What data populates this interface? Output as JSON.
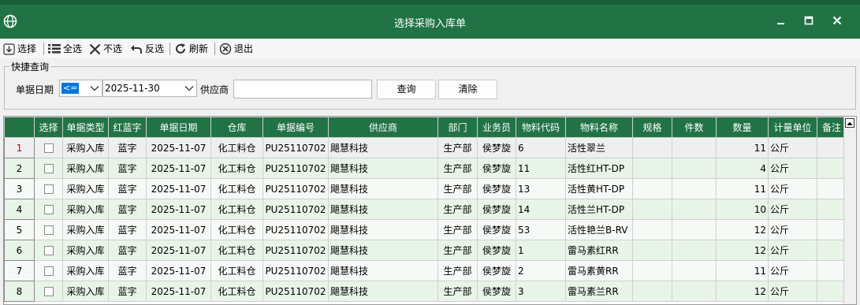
{
  "window": {
    "title": "选择采购入库单"
  },
  "toolbar": {
    "select_label": "选择",
    "select_all_label": "全选",
    "deselect_label": "不选",
    "invert_label": "反选",
    "refresh_label": "刷新",
    "exit_label": "退出"
  },
  "query": {
    "group_title": "快捷查询",
    "date_label": "单据日期",
    "operator_value": "<=",
    "date_value": "2025-11-30",
    "supplier_label": "供应商",
    "supplier_value": "",
    "search_label": "查询",
    "clear_label": "清除"
  },
  "grid": {
    "columns": [
      "选择",
      "单据类型",
      "红蓝字",
      "单据日期",
      "仓库",
      "单据编号",
      "供应商",
      "部门",
      "业务员",
      "物料代码",
      "物料名称",
      "规格",
      "件数",
      "数量",
      "计量单位",
      "备注"
    ],
    "rows": [
      {
        "num": "1",
        "type": "采购入库",
        "rb": "蓝字",
        "date": "2025-11-07",
        "wh": "化工料仓",
        "no": "PU25110702",
        "supplier": "飓慧科技",
        "dept": "生产部",
        "clerk": "侯梦旋",
        "code": "6",
        "name": "活性翠兰",
        "spec": "",
        "pcs": "",
        "qty": "11",
        "unit": "公斤",
        "note": ""
      },
      {
        "num": "2",
        "type": "采购入库",
        "rb": "蓝字",
        "date": "2025-11-07",
        "wh": "化工料仓",
        "no": "PU25110702",
        "supplier": "飓慧科技",
        "dept": "生产部",
        "clerk": "侯梦旋",
        "code": "11",
        "name": "活性红HT-DP",
        "spec": "",
        "pcs": "",
        "qty": "4",
        "unit": "公斤",
        "note": ""
      },
      {
        "num": "3",
        "type": "采购入库",
        "rb": "蓝字",
        "date": "2025-11-07",
        "wh": "化工料仓",
        "no": "PU25110702",
        "supplier": "飓慧科技",
        "dept": "生产部",
        "clerk": "侯梦旋",
        "code": "13",
        "name": "活性黄HT-DP",
        "spec": "",
        "pcs": "",
        "qty": "11",
        "unit": "公斤",
        "note": ""
      },
      {
        "num": "4",
        "type": "采购入库",
        "rb": "蓝字",
        "date": "2025-11-07",
        "wh": "化工料仓",
        "no": "PU25110702",
        "supplier": "飓慧科技",
        "dept": "生产部",
        "clerk": "侯梦旋",
        "code": "14",
        "name": "活性兰HT-DP",
        "spec": "",
        "pcs": "",
        "qty": "10",
        "unit": "公斤",
        "note": ""
      },
      {
        "num": "5",
        "type": "采购入库",
        "rb": "蓝字",
        "date": "2025-11-07",
        "wh": "化工料仓",
        "no": "PU25110702",
        "supplier": "飓慧科技",
        "dept": "生产部",
        "clerk": "侯梦旋",
        "code": "53",
        "name": "活性艳兰B-RV",
        "spec": "",
        "pcs": "",
        "qty": "12",
        "unit": "公斤",
        "note": ""
      },
      {
        "num": "6",
        "type": "采购入库",
        "rb": "蓝字",
        "date": "2025-11-07",
        "wh": "化工料仓",
        "no": "PU25110702",
        "supplier": "飓慧科技",
        "dept": "生产部",
        "clerk": "侯梦旋",
        "code": "1",
        "name": "雷马素红RR",
        "spec": "",
        "pcs": "",
        "qty": "12",
        "unit": "公斤",
        "note": ""
      },
      {
        "num": "7",
        "type": "采购入库",
        "rb": "蓝字",
        "date": "2025-11-07",
        "wh": "化工料仓",
        "no": "PU25110702",
        "supplier": "飓慧科技",
        "dept": "生产部",
        "clerk": "侯梦旋",
        "code": "2",
        "name": "雷马素黄RR",
        "spec": "",
        "pcs": "",
        "qty": "11",
        "unit": "公斤",
        "note": ""
      },
      {
        "num": "8",
        "type": "采购入库",
        "rb": "蓝字",
        "date": "2025-11-07",
        "wh": "化工料仓",
        "no": "PU25110702",
        "supplier": "飓慧科技",
        "dept": "生产部",
        "clerk": "侯梦旋",
        "code": "3",
        "name": "雷马素兰RR",
        "spec": "",
        "pcs": "",
        "qty": "12",
        "unit": "公斤",
        "note": ""
      }
    ]
  },
  "colors": {
    "theme_green": "#217346",
    "selected_row_number": "#d00000"
  }
}
